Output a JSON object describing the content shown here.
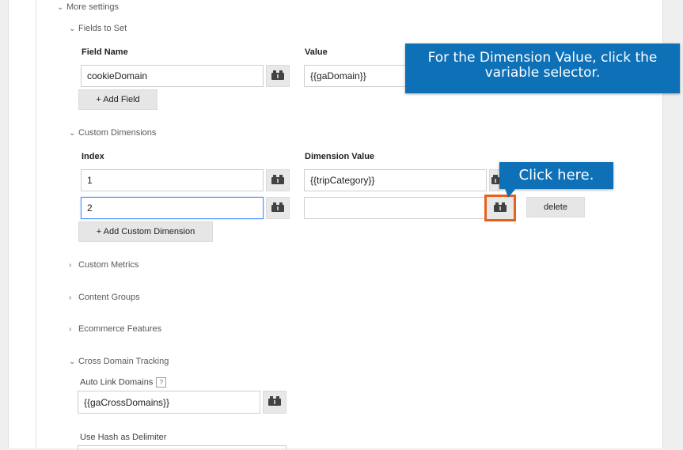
{
  "more_settings": {
    "label": "More settings"
  },
  "fields_to_set": {
    "label": "Fields to Set",
    "field_name_header": "Field Name",
    "value_header": "Value",
    "field_name_value": "cookieDomain",
    "value_value": "{{gaDomain}}",
    "add_button": "+ Add Field"
  },
  "custom_dimensions": {
    "label": "Custom Dimensions",
    "index_header": "Index",
    "dimension_value_header": "Dimension Value",
    "rows": [
      {
        "index": "1",
        "value": "{{tripCategory}}"
      },
      {
        "index": "2",
        "value": ""
      }
    ],
    "delete_label": "delete",
    "add_button": "+ Add Custom Dimension"
  },
  "collapsed_sections": [
    "Custom Metrics",
    "Content Groups",
    "Ecommerce Features"
  ],
  "cross_domain": {
    "label": "Cross Domain Tracking",
    "auto_link_label": "Auto Link Domains",
    "help": "?",
    "auto_link_value": "{{gaCrossDomains}}",
    "hash_label": "Use Hash as Delimiter"
  },
  "callouts": {
    "dimension_tip": "For the Dimension Value, click the variable selector.",
    "click_tip": "Click here."
  },
  "colors": {
    "callout_blue": "#0e71b8",
    "highlight_orange": "#e8601c",
    "focus_blue": "#4d90fe",
    "icons": [
      "chevron-down-icon",
      "chevron-right-icon",
      "variable-brick-icon",
      "help-icon"
    ]
  }
}
